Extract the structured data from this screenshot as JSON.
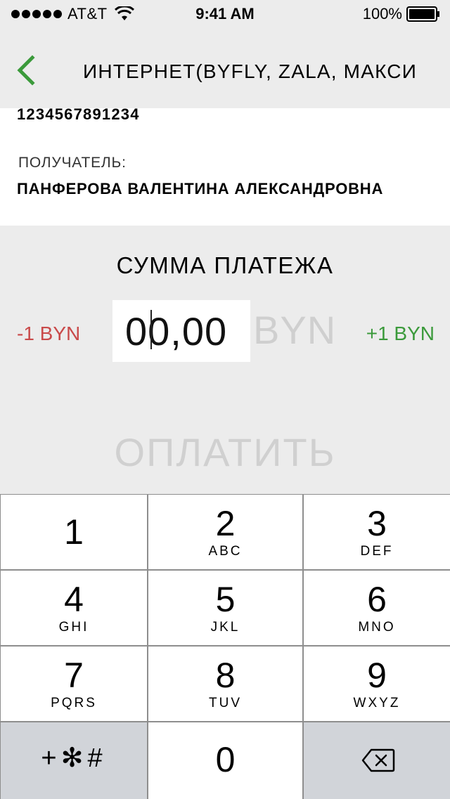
{
  "status_bar": {
    "carrier": "AT&T",
    "time": "9:41 AM",
    "battery": "100%",
    "icons": [
      "signal-dots-icon",
      "wifi-icon",
      "battery-icon"
    ]
  },
  "nav": {
    "title": "ИНТЕРНЕТ(BYFLY, ZALA, МАКСИ",
    "back_icon": "chevron-left-icon",
    "accent_color": "#3b9a3b"
  },
  "info": {
    "account_number": "1234567891234",
    "recipient_label": "ПОЛУЧАТЕЛЬ:",
    "recipient_name": "ПАНФЕРОВА ВАЛЕНТИНА АЛЕКСАНДРОВНА"
  },
  "payment": {
    "title": "СУММА ПЛАТЕЖА",
    "minus_label": "-1 BYN",
    "plus_label": "+1 BYN",
    "amount_value": "00,00",
    "currency": "BYN",
    "pay_label": "ОПЛАТИТЬ",
    "minus_color": "#c94a4a",
    "plus_color": "#3b9a3b"
  },
  "keypad": {
    "keys": [
      {
        "digit": "1",
        "letters": ""
      },
      {
        "digit": "2",
        "letters": "ABC"
      },
      {
        "digit": "3",
        "letters": "DEF"
      },
      {
        "digit": "4",
        "letters": "GHI"
      },
      {
        "digit": "5",
        "letters": "JKL"
      },
      {
        "digit": "6",
        "letters": "MNO"
      },
      {
        "digit": "7",
        "letters": "PQRS"
      },
      {
        "digit": "8",
        "letters": "TUV"
      },
      {
        "digit": "9",
        "letters": "WXYZ"
      }
    ],
    "symbols": "+✻#",
    "zero": "0",
    "delete_icon": "backspace-icon"
  }
}
